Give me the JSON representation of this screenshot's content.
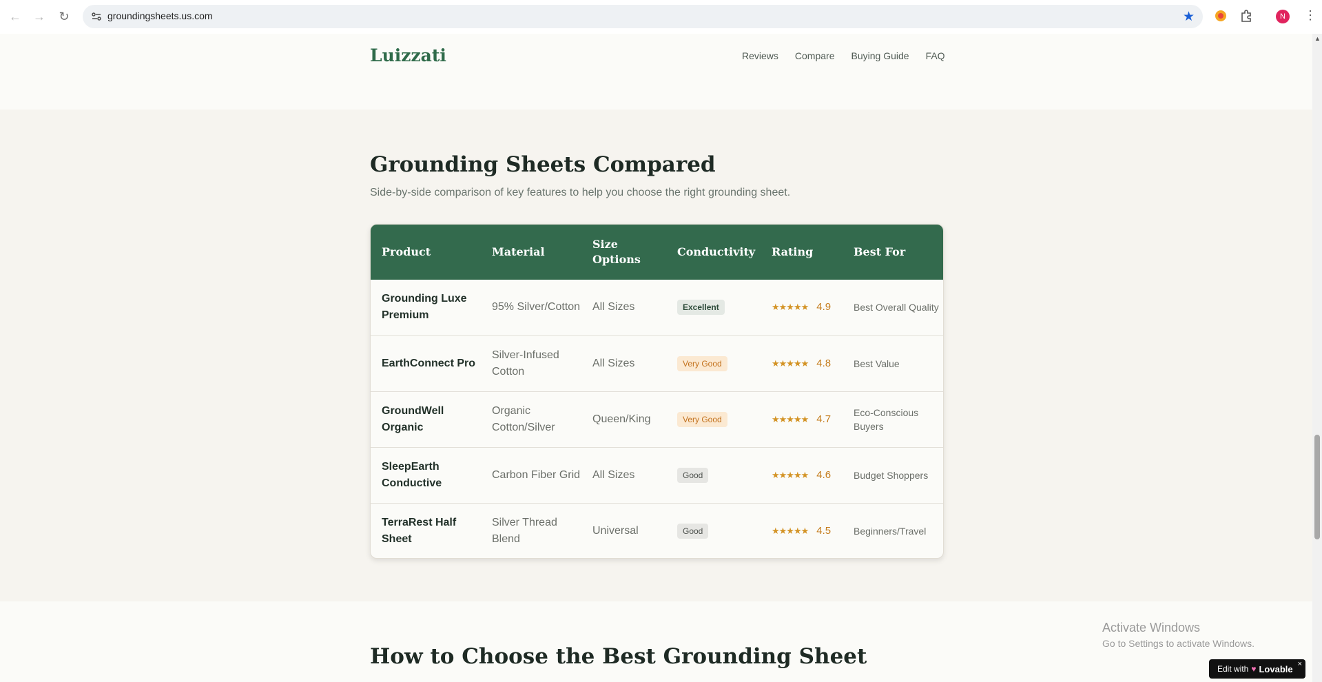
{
  "browser": {
    "url": "groundingsheets.us.com",
    "profile_initial": "N"
  },
  "header": {
    "brand": "Luizzati",
    "nav": [
      "Reviews",
      "Compare",
      "Buying Guide",
      "FAQ"
    ]
  },
  "comparison": {
    "title": "Grounding Sheets Compared",
    "subtitle": "Side-by-side comparison of key features to help you choose the right grounding sheet.",
    "columns": {
      "product": "Product",
      "material": "Material",
      "size": "Size Options",
      "conductivity": "Conductivity",
      "rating": "Rating",
      "best_for": "Best For"
    },
    "rows": [
      {
        "product": "Grounding Luxe Premium",
        "material": "95% Silver/Cotton",
        "size": "All Sizes",
        "conductivity": "Excellent",
        "stars": "★★★★★",
        "rating": "4.9",
        "best_for": "Best Overall Quality"
      },
      {
        "product": "EarthConnect Pro",
        "material": "Silver-Infused Cotton",
        "size": "All Sizes",
        "conductivity": "Very Good",
        "stars": "★★★★★",
        "rating": "4.8",
        "best_for": "Best Value"
      },
      {
        "product": "GroundWell Organic",
        "material": "Organic Cotton/Silver",
        "size": "Queen/King",
        "conductivity": "Very Good",
        "stars": "★★★★★",
        "rating": "4.7",
        "best_for": "Eco-Conscious Buyers"
      },
      {
        "product": "SleepEarth Conductive",
        "material": "Carbon Fiber Grid",
        "size": "All Sizes",
        "conductivity": "Good",
        "stars": "★★★★★",
        "rating": "4.6",
        "best_for": "Budget Shoppers"
      },
      {
        "product": "TerraRest Half Sheet",
        "material": "Silver Thread Blend",
        "size": "Universal",
        "conductivity": "Good",
        "stars": "★★★★★",
        "rating": "4.5",
        "best_for": "Beginners/Travel"
      }
    ]
  },
  "next_section": {
    "title": "How to Choose the Best Grounding Sheet"
  },
  "overlay": {
    "activate_title": "Activate Windows",
    "activate_sub": "Go to Settings to activate Windows.",
    "edit_with": "Edit with",
    "lovable": "Lovable",
    "close": "×"
  },
  "colors": {
    "brand_green": "#2f6b4a",
    "table_header": "#336a4d",
    "rating_gold": "#d39325"
  }
}
